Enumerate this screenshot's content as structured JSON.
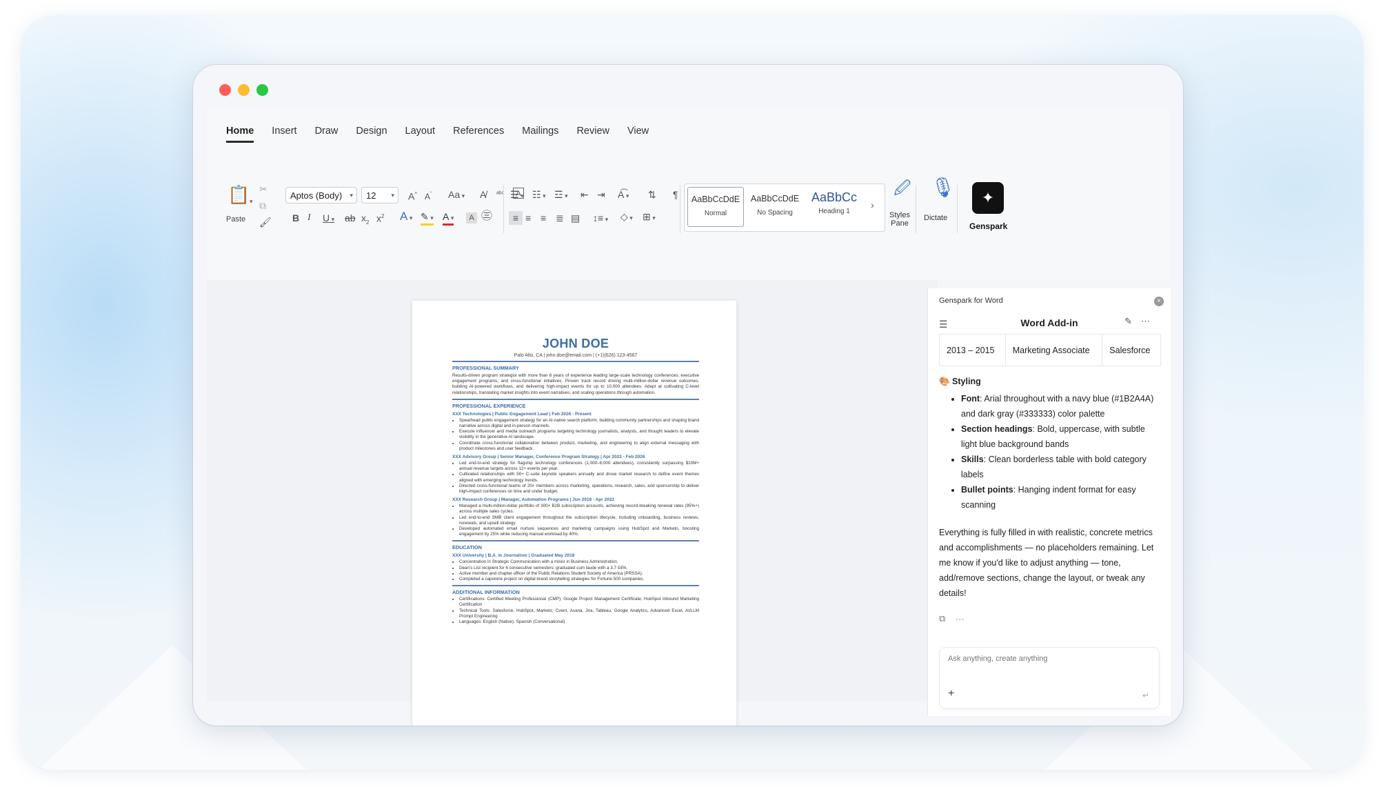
{
  "window": {
    "controls": {
      "close_color": "#ff5f57",
      "minimize_color": "#febc2e",
      "zoom_color": "#28c840"
    }
  },
  "ribbon": {
    "tabs": [
      "Home",
      "Insert",
      "Draw",
      "Design",
      "Layout",
      "References",
      "Mailings",
      "Review",
      "View"
    ],
    "active_tab": "Home",
    "paste_label": "Paste",
    "font_name": "Aptos (Body)",
    "font_size": "12",
    "styles": [
      {
        "preview": "AaBbCcDdE",
        "name": "Normal"
      },
      {
        "preview": "AaBbCcDdE",
        "name": "No Spacing"
      },
      {
        "preview": "AaBbCc",
        "name": "Heading 1"
      }
    ],
    "styles_pane_label": "Styles\nPane",
    "dictate_label": "Dictate",
    "genspark_label": "Genspark"
  },
  "document": {
    "name": "JOHN DOE",
    "contact": "Palo Alto, CA | john.doe@email.com | (+1)(626) 123-4567",
    "summary_heading": "PROFESSIONAL SUMMARY",
    "summary": "Results-driven program strategist with more than 8 years of experience leading large-scale technology conferences, executive engagement programs, and cross-functional initiatives. Proven track record driving multi-million-dollar revenue outcomes, building AI-powered workflows, and delivering high-impact events for up to 10,000 attendees. Adept at cultivating C-level relationships, translating market insights into event narratives, and scaling operations through automation.",
    "experience_heading": "PROFESSIONAL EXPERIENCE",
    "jobs": [
      {
        "title": "XXX Technologies  |  Public Engagement Lead  |  Feb 2026 - Present",
        "bullets": [
          "Spearhead public engagement strategy for an AI-native search platform, building community partnerships and shaping brand narrative across digital and in-person channels.",
          "Execute influencer and media outreach programs targeting technology journalists, analysts, and thought leaders to elevate visibility in the generative AI landscape.",
          "Coordinate cross-functional collaboration between product, marketing, and engineering to align external messaging with product milestones and user feedback."
        ]
      },
      {
        "title": "XXX Advisory Group  |  Senior Manager, Conference Program Strategy  |  Apr 2022 - Feb 2026",
        "bullets": [
          "Led end-to-end strategy for flagship technology conferences (1,000–8,000 attendees), consistently surpassing $10M+ annual revenue targets across 12+ events per year.",
          "Cultivated relationships with 50+ C-suite keynote speakers annually and drove market research to define event themes aligned with emerging technology trends.",
          "Directed cross-functional teams of 20+ members across marketing, operations, research, sales, and sponsorship to deliver high-impact conferences on time and under budget."
        ]
      },
      {
        "title": "XXX Research Group  |  Manager, Automation Programs  |  Jun 2018 - Apr 2022",
        "bullets": [
          "Managed a multi-million-dollar portfolio of 300+ B2B subscription accounts, achieving record-breaking renewal rates (95%+) across multiple sales cycles.",
          "Led end-to-end SMB client engagement throughout the subscription lifecycle, including onboarding, business reviews, renewals, and upsell strategy.",
          "Developed automated email nurture sequences and marketing campaigns using HubSpot and Marketo, boosting engagement by 25% while reducing manual workload by 40%."
        ]
      }
    ],
    "education_heading": "EDUCATION",
    "education_title": "XXX University  |  B.A. in Journalism  |  Graduated May 2018",
    "education_bullets": [
      "Concentration in Strategic Communication with a minor in Business Administration.",
      "Dean's List recipient for 6 consecutive semesters; graduated cum laude with a 3.7 GPA.",
      "Active member and chapter officer of the Public Relations Student Society of America (PRSSA).",
      "Completed a capstone project on digital brand storytelling strategies for Fortune 500 companies."
    ],
    "additional_heading": "ADDITIONAL INFORMATION",
    "additional_bullets": [
      "Certifications: Certified Meeting Professional (CMP); Google Project Management Certificate; HubSpot Inbound Marketing Certification",
      "Technical Tools: Salesforce, HubSpot, Marketo, Cvent, Asana, Jira, Tableau, Google Analytics, Advanced Excel, AI/LLM Prompt Engineering",
      "Languages: English (Native), Spanish (Conversational)"
    ]
  },
  "panel": {
    "app_title": "Genspark for Word",
    "header_title": "Word Add-in",
    "table_row": [
      "2013 – 2015",
      "Marketing Associate",
      "Salesforce"
    ],
    "styling_heading": "Styling",
    "styling_items": [
      {
        "label": "Font",
        "text": ": Arial throughout with a navy blue (#1B2A4A) and dark gray (#333333) color palette"
      },
      {
        "label": "Section headings",
        "text": ": Bold, uppercase, with subtle light blue background bands"
      },
      {
        "label": "Skills",
        "text": ": Clean borderless table with bold category labels"
      },
      {
        "label": "Bullet points",
        "text": ": Hanging indent format for easy scanning"
      }
    ],
    "summary": "Everything is fully filled in with realistic, concrete metrics and accomplishments — no placeholders remaining. Let me know if you'd like to adjust anything — tone, add/remove sections, change the layout, or tweak any details!",
    "input_placeholder": "Ask anything, create anything"
  }
}
